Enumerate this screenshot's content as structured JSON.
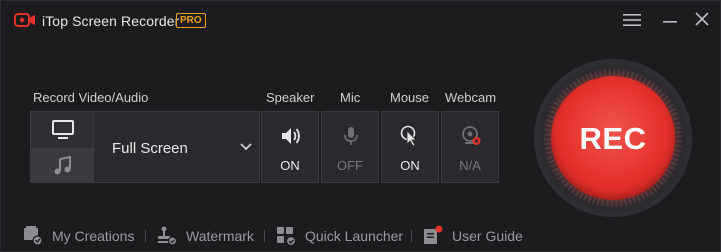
{
  "app": {
    "title": "iTop Screen Recorder",
    "badge": "PRO"
  },
  "sections": {
    "record": "Record Video/Audio",
    "speaker": "Speaker",
    "mic": "Mic",
    "mouse": "Mouse",
    "webcam": "Webcam"
  },
  "record_area": {
    "selected": "Full Screen"
  },
  "devices": {
    "speaker": {
      "state": "ON"
    },
    "mic": {
      "state": "OFF"
    },
    "mouse": {
      "state": "ON"
    },
    "webcam": {
      "state": "N/A"
    }
  },
  "rec_button": {
    "label": "REC"
  },
  "footer": {
    "my_creations": "My Creations",
    "watermark": "Watermark",
    "quick_launcher": "Quick Launcher",
    "user_guide": "User Guide"
  },
  "colors": {
    "accent_red": "#e5312c",
    "badge_orange": "#f0a020",
    "background": "#1c1c1f"
  },
  "icons": [
    "logo-icon",
    "menu-icon",
    "minimize-icon",
    "close-icon",
    "monitor-icon",
    "music-icon",
    "chevron-down-icon",
    "speaker-icon",
    "microphone-icon",
    "mouse-pointer-icon",
    "webcam-icon",
    "my-creations-icon",
    "watermark-icon",
    "quick-launcher-icon",
    "user-guide-icon"
  ]
}
